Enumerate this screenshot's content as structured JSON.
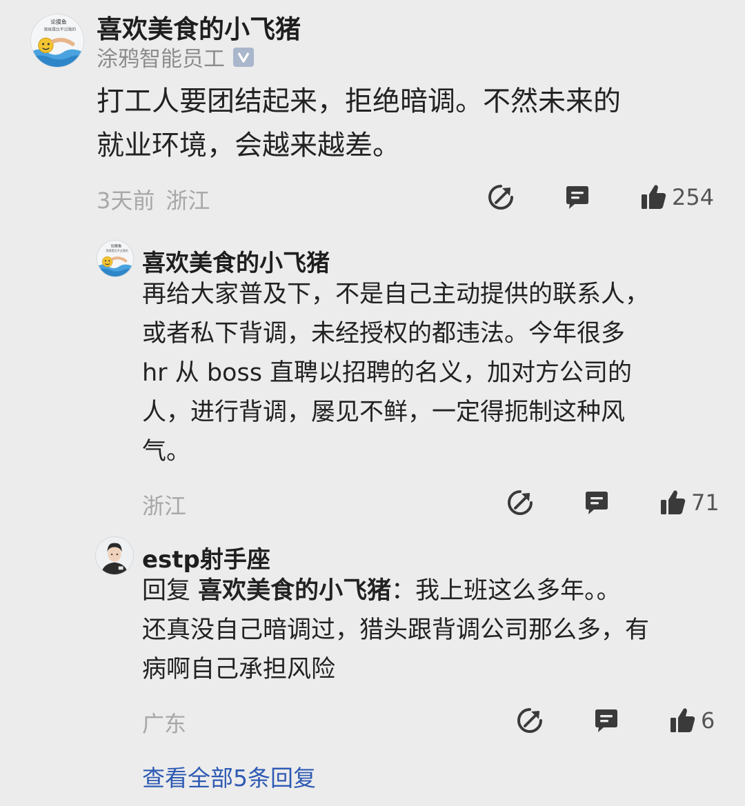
{
  "comment": {
    "author": "喜欢美食的小飞猪",
    "avatar_texts": [
      "论摸鱼",
      "我就是比不过我的"
    ],
    "badge_label": "涂鸦智能员工",
    "content_lines": [
      "打工人要团结起来，拒绝暗调。不然未来的",
      "就业环境，会越来越差。"
    ],
    "time": "3天前",
    "location": "浙江",
    "likes": "254"
  },
  "replies": [
    {
      "author": "喜欢美食的小飞猪",
      "avatar_texts": [
        "论摸鱼",
        "我就是比不过我的"
      ],
      "content_lines": [
        "再给大家普及下，不是自己主动提供的联系人，",
        "或者私下背调，未经授权的都违法。今年很多",
        "hr 从 boss 直聘以招聘的名义，加对方公司的",
        "人，进行背调，屡见不鲜，一定得扼制这种风",
        "气。"
      ],
      "location": "浙江",
      "likes": "71"
    },
    {
      "author": "estp射手座",
      "reply_prefix": "回复 ",
      "reply_to": "喜欢美食的小飞猪",
      "reply_colon": "：",
      "content_lines": [
        "我上班这么多年。。",
        "还真没自己暗调过，猎头跟背调公司那么多，有",
        "病啊自己承担风险"
      ],
      "location": "广东",
      "likes": "6"
    }
  ],
  "view_all": "查看全部5条回复",
  "icons": {
    "share": "share-arrow-icon",
    "comment": "comment-bubble-icon",
    "like": "thumbs-up-icon",
    "verified": "verified-v-icon"
  },
  "colors": {
    "background": "#ececec",
    "link": "#2e5ab3",
    "meta_text": "#a7a7a7",
    "icon": "#3a3a3a"
  }
}
